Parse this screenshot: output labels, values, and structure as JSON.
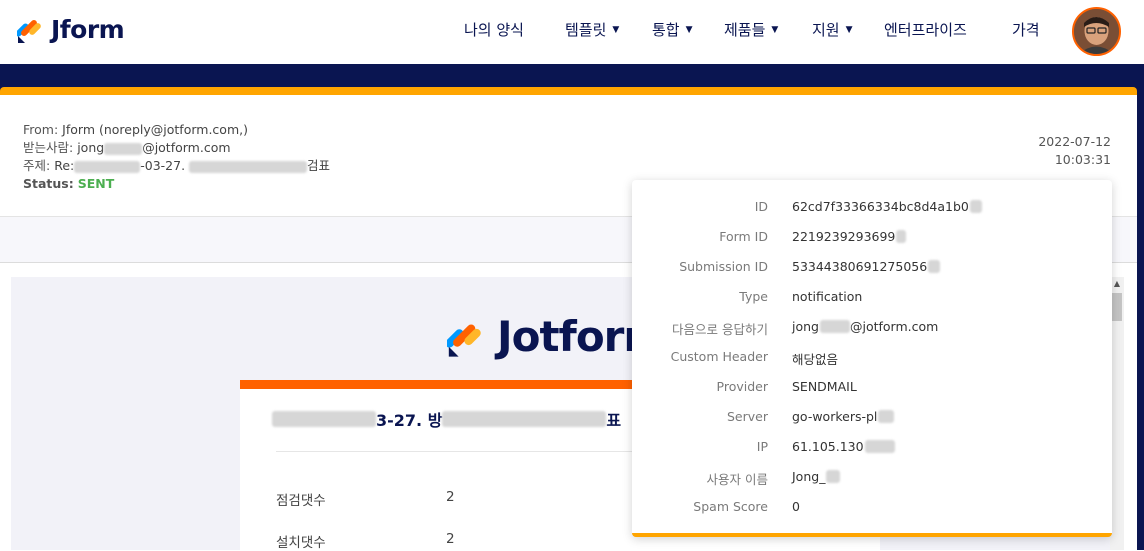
{
  "header": {
    "logo_text": "Jform",
    "nav": [
      {
        "label": "나의 양식",
        "dropdown": false
      },
      {
        "label": "템플릿",
        "dropdown": true
      },
      {
        "label": "통합",
        "dropdown": true
      },
      {
        "label": "제품들",
        "dropdown": true
      },
      {
        "label": "지원",
        "dropdown": true
      },
      {
        "label": "엔터프라이즈",
        "dropdown": false
      },
      {
        "label": "가격",
        "dropdown": false
      }
    ]
  },
  "email": {
    "from_label": "From:",
    "from_value": "Jform (noreply@jotform.com,)",
    "to_label": "받는사람:",
    "to_prefix": "jong",
    "to_suffix": "@jotform.com",
    "subject_label": "주제:",
    "subject_prefix": "Re:",
    "subject_mid": "-03-27.",
    "subject_suffix": "검표",
    "status_label": "Status:",
    "status_value": "SENT",
    "date": "2022-07-12",
    "time": "10:03:31"
  },
  "preview": {
    "logo_text": "Jotform",
    "form_title_visible": "3-27. 방",
    "form_title_end": "표",
    "rows": [
      {
        "label": "점검댓수",
        "value": "2"
      },
      {
        "label": "설치댓수",
        "value": "2"
      }
    ]
  },
  "details": {
    "fields": [
      {
        "label": "ID",
        "value": "62cd7f33366334bc8d4a1b0"
      },
      {
        "label": "Form ID",
        "value": "2219239293699"
      },
      {
        "label": "Submission ID",
        "value": "53344380691275056"
      },
      {
        "label": "Type",
        "value": "notification"
      },
      {
        "label": "다음으로 응답하기",
        "value": "jong",
        "value2": "@jotform.com"
      },
      {
        "label": "Custom Header",
        "value": "해당없음"
      },
      {
        "label": "Provider",
        "value": "SENDMAIL"
      },
      {
        "label": "Server",
        "value": "go-workers-pl"
      },
      {
        "label": "IP",
        "value": "61.105.130"
      },
      {
        "label": "사용자 이름",
        "value": "Jong_"
      },
      {
        "label": "Spam Score",
        "value": "0"
      }
    ]
  },
  "colors": {
    "navy": "#0a1551",
    "orange": "#ff6100",
    "amber": "#ffa500",
    "status_green": "#4caf50"
  }
}
